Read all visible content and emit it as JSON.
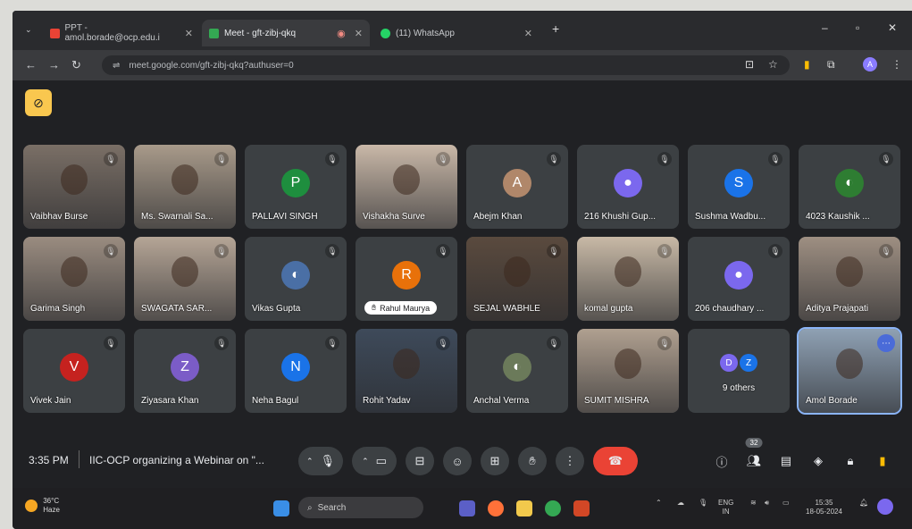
{
  "browser": {
    "tabs": [
      {
        "title": "PPT - amol.borade@ocp.edu.i",
        "color": "#ea4335",
        "active": false
      },
      {
        "title": "Meet - gft-zibj-qkq",
        "color": "#34a853",
        "active": true
      },
      {
        "title": "(11) WhatsApp",
        "color": "#25d366",
        "active": false
      }
    ],
    "url": "meet.google.com/gft-zibj-qkq?authuser=0",
    "profile_initial": "A"
  },
  "participants": [
    {
      "name": "Vaibhav Burse",
      "type": "photo",
      "bg": "#7a6f66"
    },
    {
      "name": "Ms. Swarnali Sa...",
      "type": "photo",
      "bg": "#a89a8a"
    },
    {
      "name": "PALLAVI SINGH",
      "type": "initial",
      "initial": "P",
      "color": "#1e8e3e"
    },
    {
      "name": "Vishakha Surve",
      "type": "photo",
      "bg": "#c9b8a8"
    },
    {
      "name": "Abejm Khan",
      "type": "initial",
      "initial": "A",
      "color": "#b0876a"
    },
    {
      "name": "216 Khushi Gup...",
      "type": "icon",
      "color": "#7b68ee"
    },
    {
      "name": "Sushma Wadbu...",
      "type": "initial",
      "initial": "S",
      "color": "#1a73e8"
    },
    {
      "name": "4023 Kaushik ...",
      "type": "avatar",
      "color": "#2e7d32"
    },
    {
      "name": "Garima Singh",
      "type": "photo",
      "bg": "#9a8c80"
    },
    {
      "name": "SWAGATA SAR...",
      "type": "photo",
      "bg": "#b5a596"
    },
    {
      "name": "Vikas Gupta",
      "type": "avatar",
      "color": "#4a6fa5"
    },
    {
      "name": "Rahul Maurya",
      "type": "initial",
      "initial": "R",
      "color": "#e8710a",
      "pill": true
    },
    {
      "name": "SEJAL WABHLE",
      "type": "photo",
      "bg": "#5a4a3e"
    },
    {
      "name": "komal gupta",
      "type": "photo",
      "bg": "#c8b9a6"
    },
    {
      "name": "206 chaudhary ...",
      "type": "icon",
      "color": "#7b68ee"
    },
    {
      "name": "Aditya Prajapati",
      "type": "photo",
      "bg": "#9e8f82"
    },
    {
      "name": "Vivek Jain",
      "type": "initial",
      "initial": "V",
      "color": "#c5221f"
    },
    {
      "name": "Ziyasara Khan",
      "type": "initial",
      "initial": "Z",
      "color": "#7b5cc7"
    },
    {
      "name": "Neha Bagul",
      "type": "initial",
      "initial": "N",
      "color": "#1a73e8"
    },
    {
      "name": "Rohit Yadav",
      "type": "photo",
      "bg": "#3e4a5a"
    },
    {
      "name": "Anchal Verma",
      "type": "avatar",
      "color": "#6b7a5a"
    },
    {
      "name": "SUMIT MISHRA",
      "type": "photo",
      "bg": "#b0a090"
    },
    {
      "name": "9 others",
      "type": "others",
      "initials": [
        "D",
        "Z"
      ]
    },
    {
      "name": "Amol Borade",
      "type": "photo",
      "bg": "#8fa1b4",
      "active": true
    }
  ],
  "controls": {
    "time": "3:35 PM",
    "meeting_title": "IIC-OCP organizing a Webinar on \"...",
    "people_count": "32"
  },
  "taskbar": {
    "weather_temp": "36°C",
    "weather_desc": "Haze",
    "search": "Search",
    "lang_top": "ENG",
    "lang_bottom": "IN",
    "clock_time": "15:35",
    "clock_date": "18-05-2024"
  }
}
